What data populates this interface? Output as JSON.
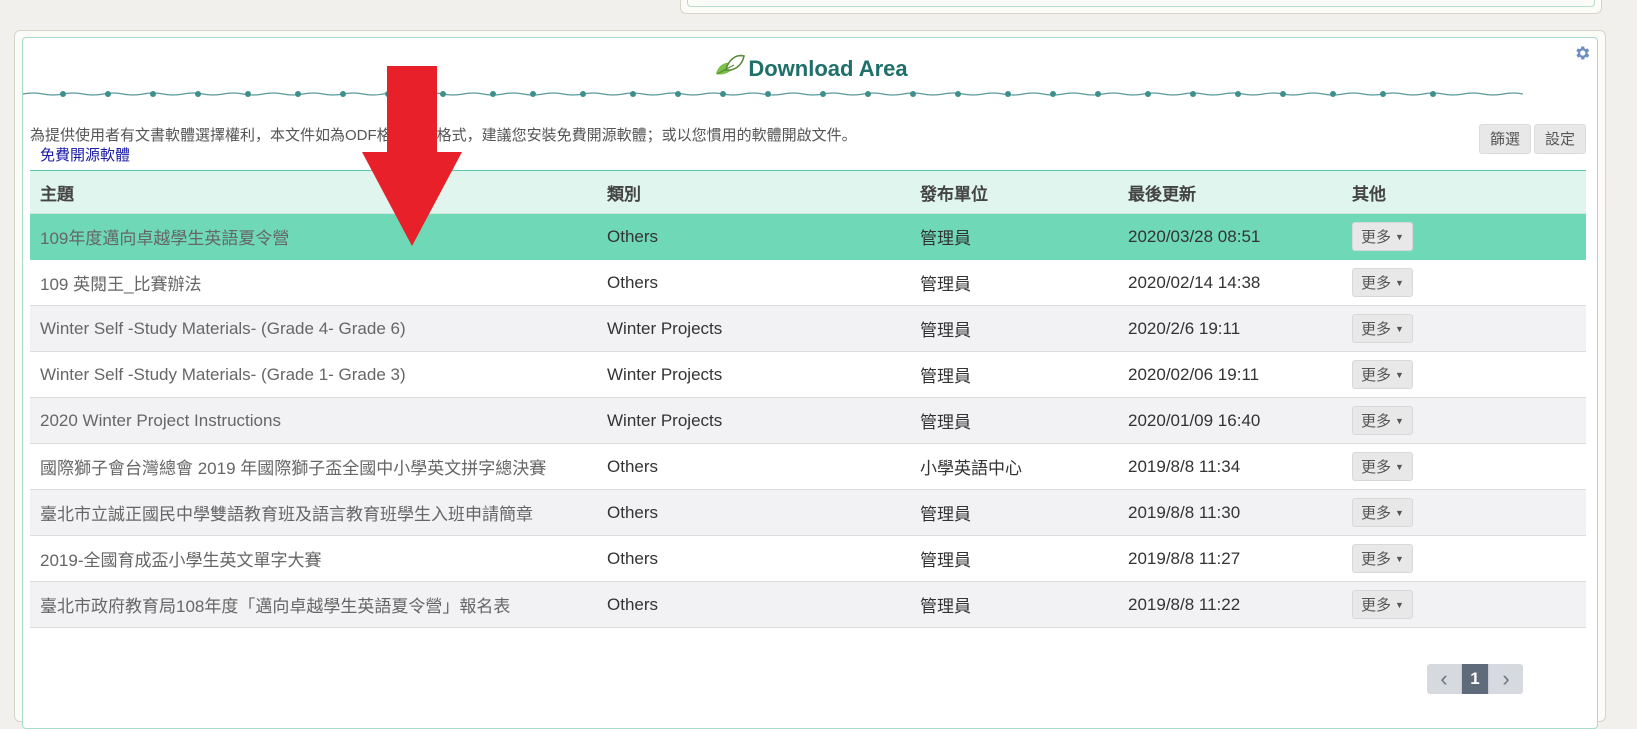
{
  "header": {
    "title": "Download Area"
  },
  "notice": {
    "text": "為提供使用者有文書軟體選擇權利，本文件如為ODF格式文件格式，建議您安裝免費開源軟體；或以您慣用的軟體開啟文件。",
    "link_label": "免費開源軟體"
  },
  "toolbar": {
    "filter_label": "篩選",
    "settings_label": "設定"
  },
  "table": {
    "headers": [
      "主題",
      "類別",
      "發布單位",
      "最後更新",
      "其他"
    ],
    "more_label": "更多",
    "rows": [
      {
        "topic": "109年度邁向卓越學生英語夏令營",
        "category": "Others",
        "unit": "管理員",
        "updated": "2020/03/28 08:51"
      },
      {
        "topic": "109 英閱王_比賽辦法",
        "category": "Others",
        "unit": "管理員",
        "updated": "2020/02/14 14:38"
      },
      {
        "topic": "Winter Self -Study Materials- (Grade 4- Grade 6)",
        "category": "Winter Projects",
        "unit": "管理員",
        "updated": "2020/2/6 19:11"
      },
      {
        "topic": "Winter Self -Study Materials- (Grade 1- Grade 3)",
        "category": "Winter Projects",
        "unit": "管理員",
        "updated": "2020/02/06 19:11"
      },
      {
        "topic": "2020 Winter Project Instructions",
        "category": "Winter Projects",
        "unit": "管理員",
        "updated": "2020/01/09 16:40"
      },
      {
        "topic": "國際獅子會台灣總會 2019 年國際獅子盃全國中小學英文拼字總決賽",
        "category": "Others",
        "unit": "小學英語中心",
        "updated": "2019/8/8 11:34"
      },
      {
        "topic": "臺北市立誠正國民中學雙語教育班及語言教育班學生入班申請簡章",
        "category": "Others",
        "unit": "管理員",
        "updated": "2019/8/8 11:30"
      },
      {
        "topic": "2019-全國育成盃小學生英文單字大賽",
        "category": "Others",
        "unit": "管理員",
        "updated": "2019/8/8 11:27"
      },
      {
        "topic": "臺北市政府教育局108年度「邁向卓越學生英語夏令營」報名表",
        "category": "Others",
        "unit": "管理員",
        "updated": "2019/8/8 11:22"
      }
    ]
  },
  "pagination": {
    "prev": "‹",
    "current": "1",
    "next": "›"
  },
  "icons": {
    "settings": "gear-icon",
    "logo": "leaf-icon",
    "annotation": "red-down-arrow"
  },
  "colors": {
    "accent": "#6ed8b7",
    "title": "#1f6f6a",
    "arrow": "#e8202a"
  }
}
